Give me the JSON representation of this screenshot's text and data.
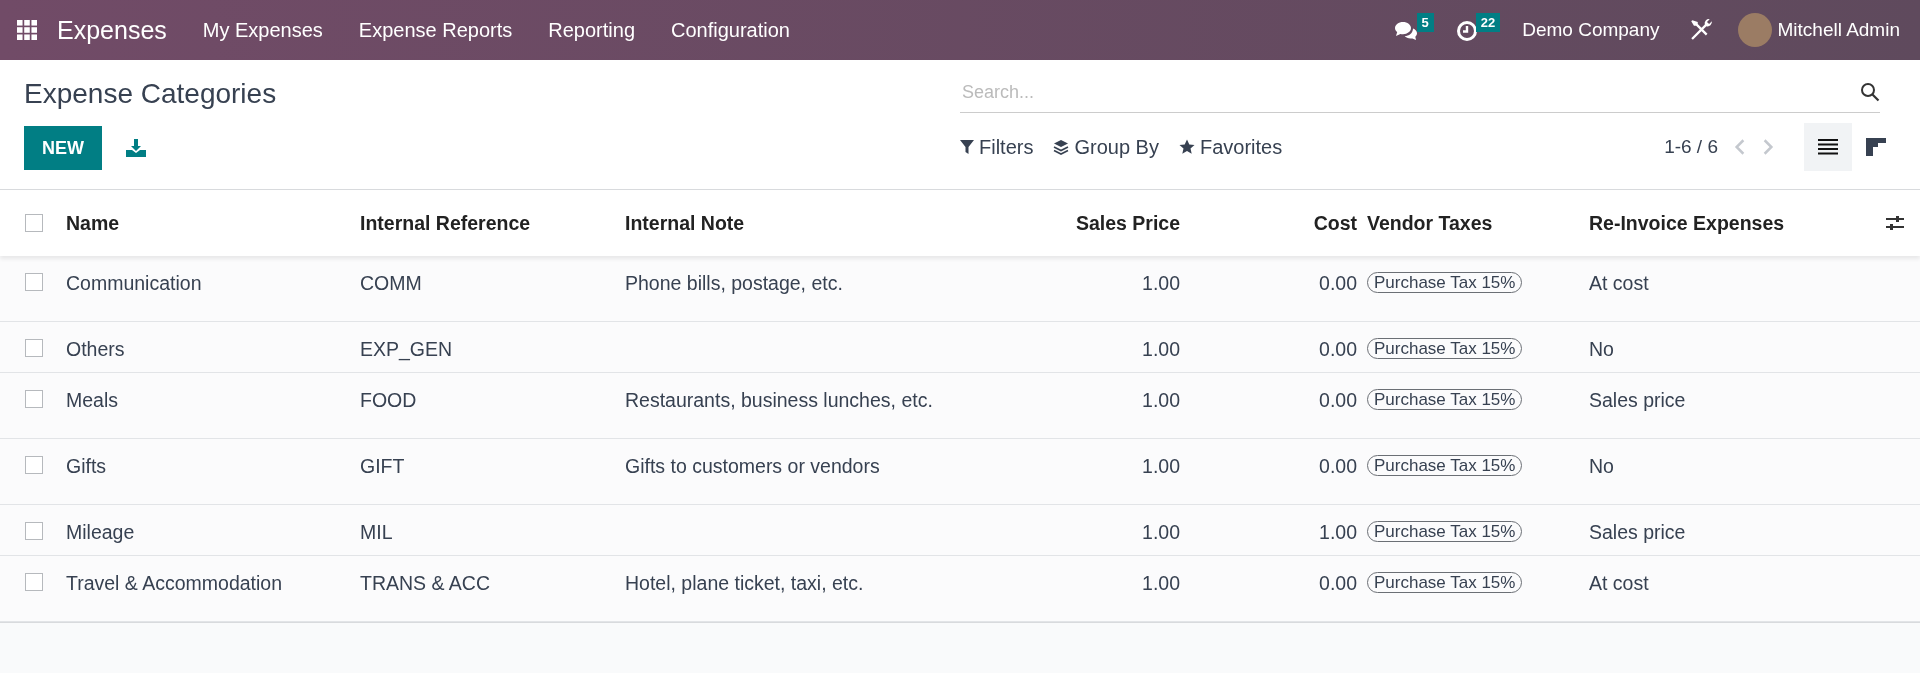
{
  "navbar": {
    "app_name": "Expenses",
    "menu": [
      "My Expenses",
      "Expense Reports",
      "Reporting",
      "Configuration"
    ],
    "messages_count": "5",
    "activities_count": "22",
    "company": "Demo Company",
    "user": "Mitchell Admin"
  },
  "page": {
    "title": "Expense Categories",
    "new_button": "NEW"
  },
  "search": {
    "placeholder": "Search..."
  },
  "filters": [
    {
      "kind": "filter",
      "label": "Filters"
    },
    {
      "kind": "group",
      "label": "Group By"
    },
    {
      "kind": "favorite",
      "label": "Favorites"
    }
  ],
  "pager": "1-6 / 6",
  "views": [
    {
      "kind": "list",
      "selected": true
    },
    {
      "kind": "kanban",
      "selected": false
    }
  ],
  "table": {
    "select_all": false,
    "columns": [
      "Name",
      "Internal Reference",
      "Internal Note",
      "Sales Price",
      "Cost",
      "Vendor Taxes",
      "Re-Invoice Expenses"
    ],
    "rows": [
      {
        "name": "Communication",
        "ref": "COMM",
        "note": "Phone bills, postage, etc.",
        "price": "1.00",
        "cost": "0.00",
        "tax": "Purchase Tax 15%",
        "reinvoice": "At cost",
        "checked": false
      },
      {
        "name": "Others",
        "ref": "EXP_GEN",
        "price": "1.00",
        "cost": "0.00",
        "tax": "Purchase Tax 15%",
        "reinvoice": "No",
        "checked": false
      },
      {
        "name": "Meals",
        "ref": "FOOD",
        "note": "Restaurants, business lunches, etc.",
        "price": "1.00",
        "cost": "0.00",
        "tax": "Purchase Tax 15%",
        "reinvoice": "Sales price",
        "checked": false
      },
      {
        "name": "Gifts",
        "ref": "GIFT",
        "note": "Gifts to customers or vendors",
        "price": "1.00",
        "cost": "0.00",
        "tax": "Purchase Tax 15%",
        "reinvoice": "No",
        "checked": false
      },
      {
        "name": "Mileage",
        "ref": "MIL",
        "price": "1.00",
        "cost": "1.00",
        "tax": "Purchase Tax 15%",
        "reinvoice": "Sales price",
        "checked": false
      },
      {
        "name": "Travel & Accommodation",
        "ref": "TRANS & ACC",
        "note": "Hotel, plane ticket, taxi, etc.",
        "price": "1.00",
        "cost": "0.00",
        "tax": "Purchase Tax 15%",
        "reinvoice": "At cost",
        "checked": false
      }
    ]
  }
}
